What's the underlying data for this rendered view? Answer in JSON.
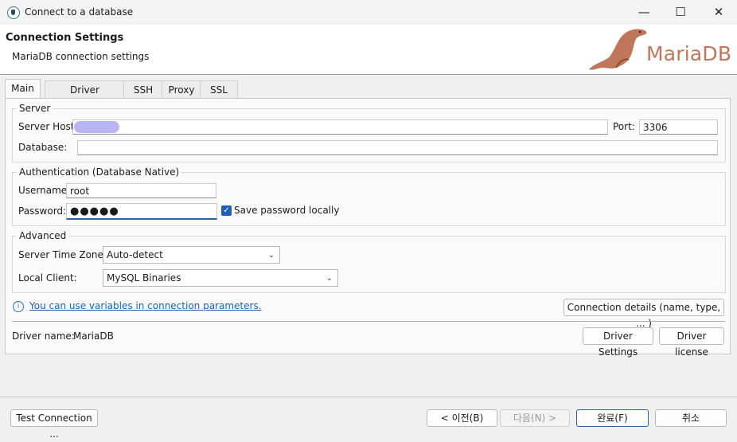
{
  "window": {
    "title": "Connect to a database",
    "minimize": "—",
    "maximize": "☐",
    "close": "✕"
  },
  "header": {
    "title": "Connection Settings",
    "subtitle": "MariaDB connection settings",
    "logo_text": "MariaDB"
  },
  "tabs": [
    {
      "label": "Main",
      "active": true
    },
    {
      "label": "Driver properties",
      "active": false
    },
    {
      "label": "SSH",
      "active": false
    },
    {
      "label": "Proxy",
      "active": false
    },
    {
      "label": "SSL",
      "active": false
    }
  ],
  "server": {
    "group_label": "Server",
    "host_label": "Server Host:",
    "host_value": "",
    "port_label": "Port:",
    "port_value": "3306",
    "database_label": "Database:",
    "database_value": ""
  },
  "auth": {
    "group_label": "Authentication (Database Native)",
    "username_label": "Username:",
    "username_value": "root",
    "password_label": "Password:",
    "password_value": "●●●●●",
    "save_password_label": "Save password locally",
    "save_password_checked": true
  },
  "advanced": {
    "group_label": "Advanced",
    "timezone_label": "Server Time Zone:",
    "timezone_value": "Auto-detect",
    "client_label": "Local Client:",
    "client_value": "MySQL Binaries"
  },
  "info": {
    "variables_link": "You can use variables in connection parameters.",
    "details_button": "Connection details (name, type, ... )"
  },
  "driver": {
    "name_label": "Driver name:",
    "name_value": "MariaDB",
    "settings_button": "Driver Settings",
    "license_button": "Driver license"
  },
  "footer": {
    "test_button": "Test Connection ...",
    "back_button": "< 이전(B)",
    "next_button": "다음(N) >",
    "finish_button": "완료(F)",
    "cancel_button": "취소"
  },
  "colors": {
    "accent": "#1f5fb5",
    "logo": "#c0765a",
    "link": "#1a63b8"
  }
}
